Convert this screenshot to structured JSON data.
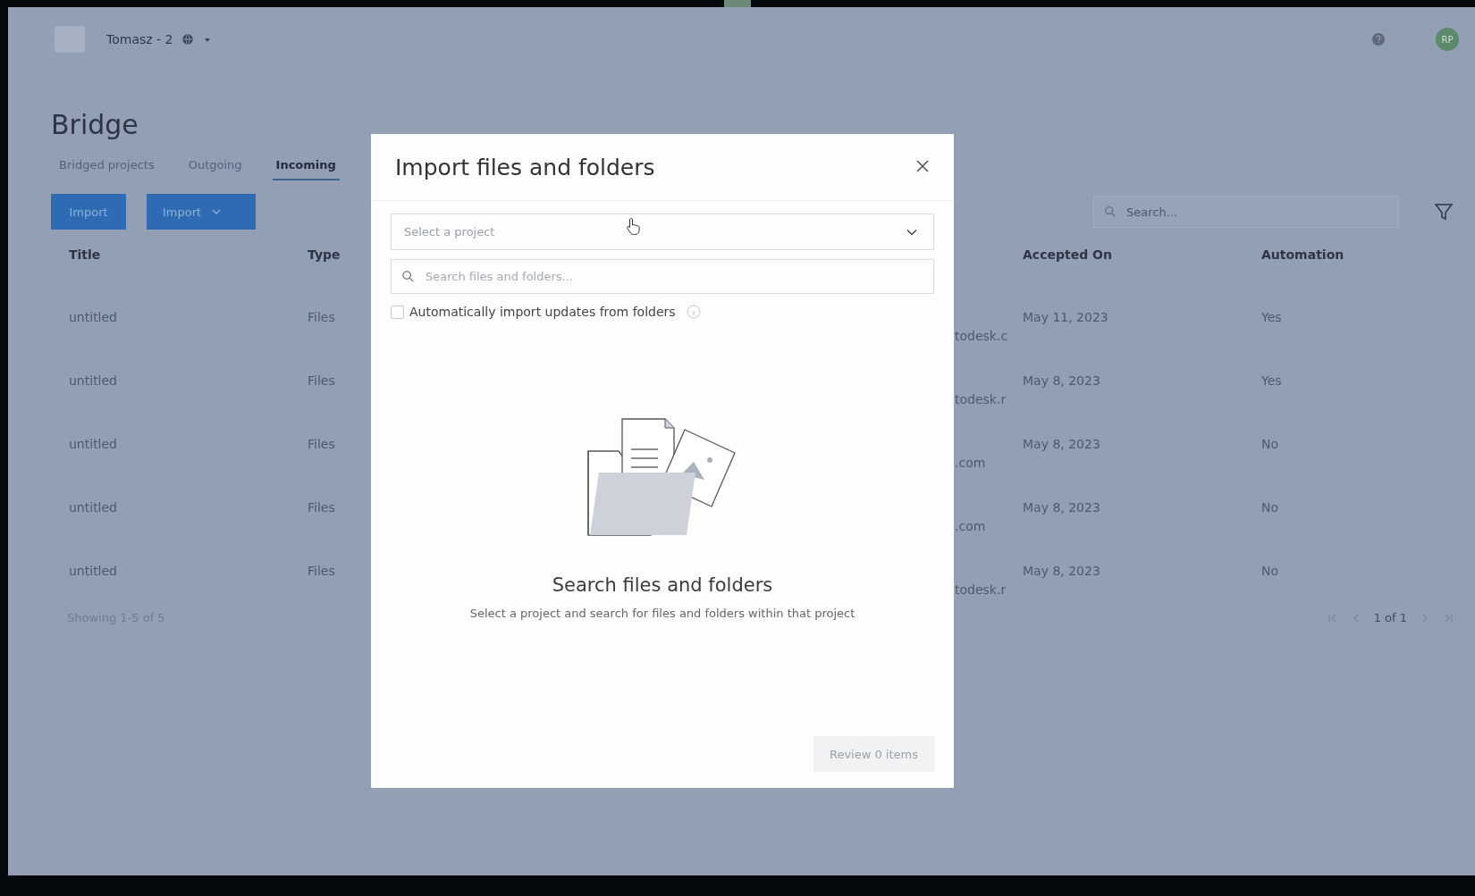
{
  "header": {
    "account": "Tomasz - 2",
    "avatar": "RP"
  },
  "page": {
    "title": "Bridge",
    "tabs": [
      {
        "label": "Bridged projects",
        "selected": false
      },
      {
        "label": "Outgoing",
        "selected": false
      },
      {
        "label": "Incoming",
        "selected": true
      }
    ],
    "buttons": [
      {
        "label": "Import",
        "kind": "plain"
      },
      {
        "label": "Import",
        "kind": "dropdown"
      }
    ],
    "search": {
      "placeholder": "Search..."
    }
  },
  "table": {
    "columns": [
      "Title",
      "Type",
      "Accepted On",
      "Automation"
    ],
    "rows": [
      {
        "title": "untitled",
        "type": "Files",
        "column_3": "todesk.c",
        "accepted_on": "May 11, 2023",
        "automation": "Yes"
      },
      {
        "title": "untitled",
        "type": "Files",
        "column_3": "todesk.r",
        "accepted_on": "May 8, 2023",
        "automation": "Yes"
      },
      {
        "title": "untitled",
        "type": "Files",
        "column_3": ".com",
        "accepted_on": "May 8, 2023",
        "automation": "No"
      },
      {
        "title": "untitled",
        "type": "Files",
        "column_3": ".com",
        "accepted_on": "May 8, 2023",
        "automation": "No"
      },
      {
        "title": "untitled",
        "type": "Files",
        "column_3": "todesk.r",
        "accepted_on": "May 8, 2023",
        "automation": "No"
      }
    ],
    "footer": "Showing 1-5 of 5",
    "pagination": "1 of 1"
  },
  "dialog": {
    "title": "Import files and folders",
    "project_select": {
      "placeholder": "Select a project"
    },
    "search": {
      "placeholder": "Search files and folders..."
    },
    "auto_import": {
      "label": "Automatically import updates from folders",
      "checked": false
    },
    "empty_title": "Search files and folders",
    "empty_text": "Select a project and search for files and folders within that project",
    "review_button": {
      "label": "Review 0 items",
      "disabled": true
    }
  }
}
